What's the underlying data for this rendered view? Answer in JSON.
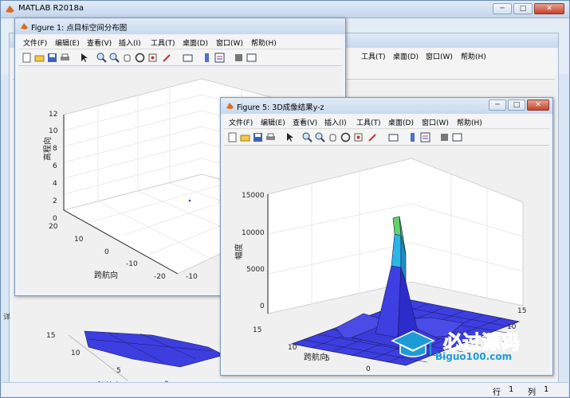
{
  "app": {
    "title": "MATLAB R2018a"
  },
  "status": {
    "row_label": "行",
    "row_value": "1",
    "col_label": "列",
    "col_value": "1"
  },
  "menu": [
    "文件(F)",
    "编辑(E)",
    "查看(V)",
    "插入(I)",
    "工具(T)",
    "桌面(D)",
    "窗口(W)",
    "帮助(H)"
  ],
  "bg_window": {
    "menu_visible": [
      "工具(T)",
      "桌面(D)",
      "窗口(W)",
      "帮助(H)"
    ],
    "ylabel": "跨航向",
    "ticks_left": [
      "15",
      "10",
      "5",
      "0"
    ],
    "ticks_bottom": [
      "0"
    ],
    "side_char": "详"
  },
  "figure1": {
    "title": "Figure 1: 点目标空间分布图",
    "ylabel": "高程向",
    "xlabel": "跨航向",
    "z_ticks": [
      "12",
      "10",
      "8",
      "6",
      "4",
      "2",
      "0"
    ],
    "y_ticks": [
      "20",
      "10",
      "0",
      "-10",
      "-20"
    ],
    "x_ticks": [
      "-10"
    ]
  },
  "figure5": {
    "title": "Figure 5: 3D成像结果y-z",
    "zlabel": "幅度",
    "xlabel": "跨航向",
    "z_ticks": [
      "15000",
      "10000",
      "5000",
      "0"
    ],
    "y_ticks": [
      "15",
      "10",
      "5",
      "0"
    ],
    "x_ticks": [
      "0",
      "5",
      "10",
      "15"
    ]
  },
  "watermark": {
    "text_cn": "必过源码",
    "text_en": "Biguo100.com"
  },
  "colors": {
    "surface": "#3d3ee0",
    "peak_cyan": "#29b6e8",
    "peak_green": "#5fd36a",
    "window_bg": "#d9e6f4"
  },
  "chart_data": [
    {
      "type": "scatter",
      "title": "",
      "xlabel": "跨航向",
      "ylabel": "",
      "zlabel": "高程向",
      "zlim": [
        0,
        12
      ],
      "ylim": [
        -20,
        20
      ],
      "points": [
        {
          "x": 0,
          "y": 0,
          "z": 0
        }
      ]
    },
    {
      "type": "area",
      "title": "",
      "xlabel": "跨航向",
      "zlabel": "幅度",
      "zlim": [
        0,
        15000
      ],
      "xlim": [
        0,
        15
      ],
      "ylim": [
        0,
        15
      ],
      "peak_value": 12000
    }
  ]
}
